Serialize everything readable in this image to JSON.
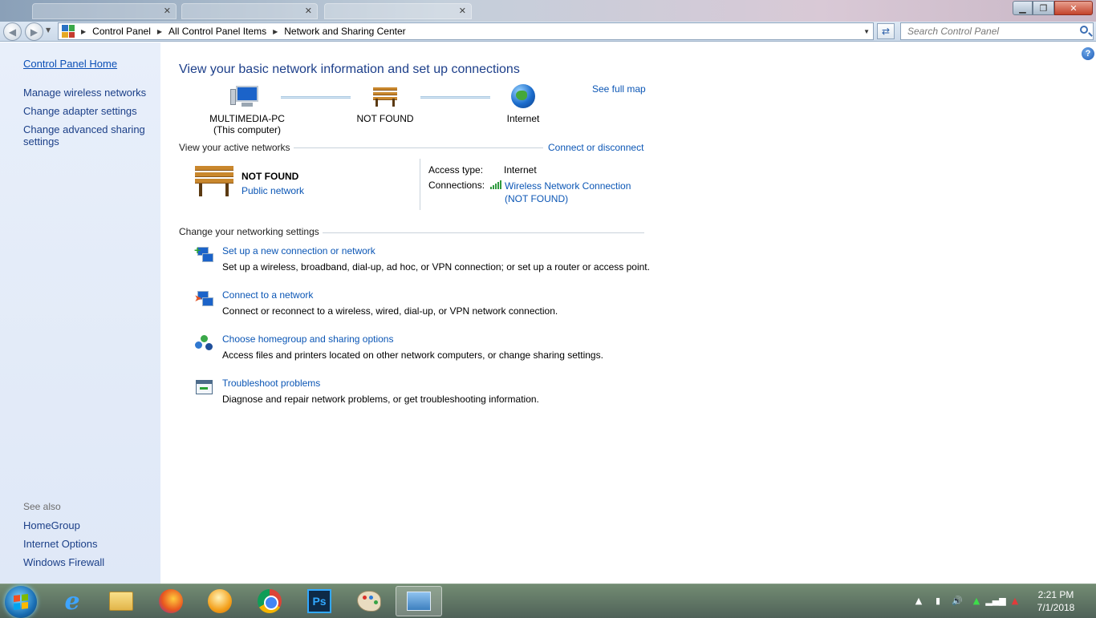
{
  "window": {
    "min_glyph": "▁",
    "max_glyph": "❐",
    "close_glyph": "✕"
  },
  "address_bar": {
    "crumbs": [
      "Control Panel",
      "All Control Panel Items",
      "Network and Sharing Center"
    ],
    "search_placeholder": "Search Control Panel"
  },
  "sidebar": {
    "home_link": "Control Panel Home",
    "items": [
      "Manage wireless networks",
      "Change adapter settings",
      "Change advanced sharing",
      "settings"
    ],
    "see_also_label": "See also",
    "see_also": [
      "HomeGroup",
      "Internet Options",
      "Windows Firewall"
    ]
  },
  "main": {
    "title": "View your basic network information and set up connections",
    "see_full_map": "See full map",
    "map": {
      "computer_name": "MULTIMEDIA-PC",
      "computer_sub": "(This computer)",
      "network_name": "NOT FOUND",
      "internet": "Internet"
    },
    "active_networks_label": "View your active networks",
    "connect_or_disconnect": "Connect or disconnect",
    "active_network": {
      "name": "NOT FOUND",
      "type": "Public network",
      "access_type_label": "Access type:",
      "access_type_value": "Internet",
      "connections_label": "Connections:",
      "connection_line1": "Wireless Network Connection",
      "connection_line2": "(NOT FOUND)"
    },
    "change_settings_label": "Change your networking settings",
    "tasks": [
      {
        "link": "Set up a new connection or network",
        "desc": "Set up a wireless, broadband, dial-up, ad hoc, or VPN connection; or set up a router or access point."
      },
      {
        "link": "Connect to a network",
        "desc": "Connect or reconnect to a wireless, wired, dial-up, or VPN network connection."
      },
      {
        "link": "Choose homegroup and sharing options",
        "desc": "Access files and printers located on other network computers, or change sharing settings."
      },
      {
        "link": "Troubleshoot problems",
        "desc": "Diagnose and repair network problems, or get troubleshooting information."
      }
    ]
  },
  "taskbar": {
    "ps_label": "Ps",
    "ie_label": "e",
    "clock_time": "2:21 PM",
    "clock_date": "7/1/2018"
  },
  "colors": {
    "link": "#0b56b5",
    "title": "#1d3f8a",
    "sidebar_bg": "#e3ebf8"
  }
}
